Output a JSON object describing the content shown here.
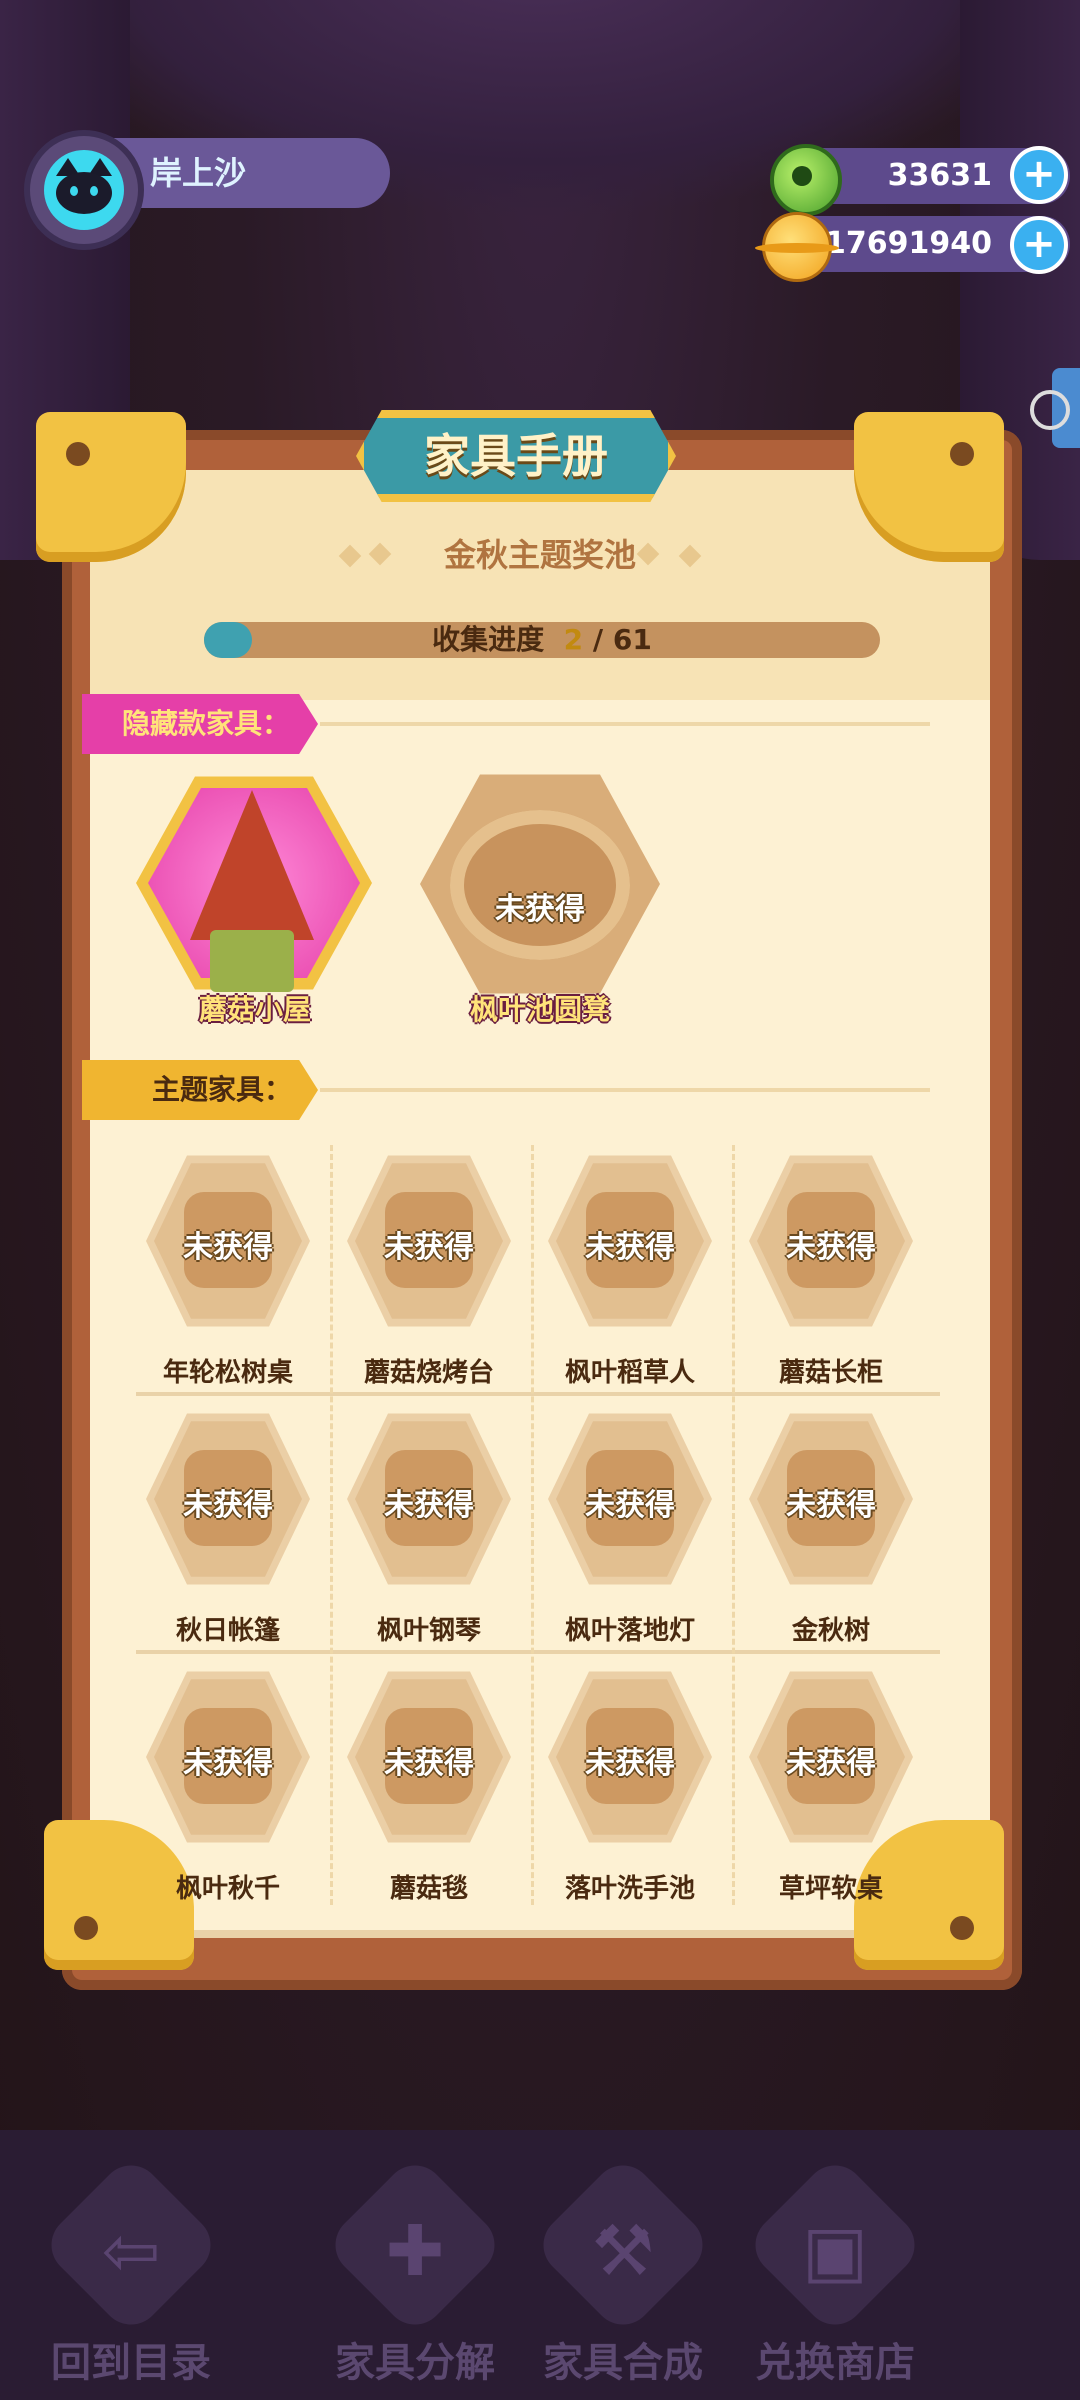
{
  "header": {
    "player_name": "岸上沙",
    "currencies": [
      {
        "icon": "green-donut-coin-icon",
        "value": "33631"
      },
      {
        "icon": "gold-planet-coin-icon",
        "value": "17691940"
      }
    ],
    "add_label": "+"
  },
  "book": {
    "title": "家具手册",
    "pool_title": "金秋主题奖池",
    "progress": {
      "label": "收集进度",
      "current": "2",
      "separator": "/",
      "total": "61",
      "fraction": 0.033
    },
    "hidden_section": {
      "label": "隐藏款家具：",
      "items": [
        {
          "name": "蘑菇小屋",
          "obtained": true
        },
        {
          "name": "枫叶池圆凳",
          "obtained": false,
          "status": "未获得"
        }
      ]
    },
    "theme_section": {
      "label": "主题家具：",
      "locked_text": "未获得",
      "rows": [
        [
          "年轮松树桌",
          "蘑菇烧烤台",
          "枫叶稻草人",
          "蘑菇长柜"
        ],
        [
          "秋日帐篷",
          "枫叶钢琴",
          "枫叶落地灯",
          "金秋树"
        ],
        [
          "枫叶秋千",
          "蘑菇毯",
          "落叶洗手池",
          "草坪软桌"
        ]
      ]
    }
  },
  "nav": [
    {
      "label": "回到目录",
      "icon": "back-arrow-icon"
    },
    {
      "label": "家具分解",
      "icon": "puzzle-icon"
    },
    {
      "label": "家具合成",
      "icon": "hammer-icon"
    },
    {
      "label": "兑换商店",
      "icon": "gift-icon"
    }
  ],
  "colors": {
    "accent_teal": "#3b9aa6",
    "gold": "#f2c243",
    "pink": "#e53fa8",
    "page": "#fdf1d3"
  }
}
